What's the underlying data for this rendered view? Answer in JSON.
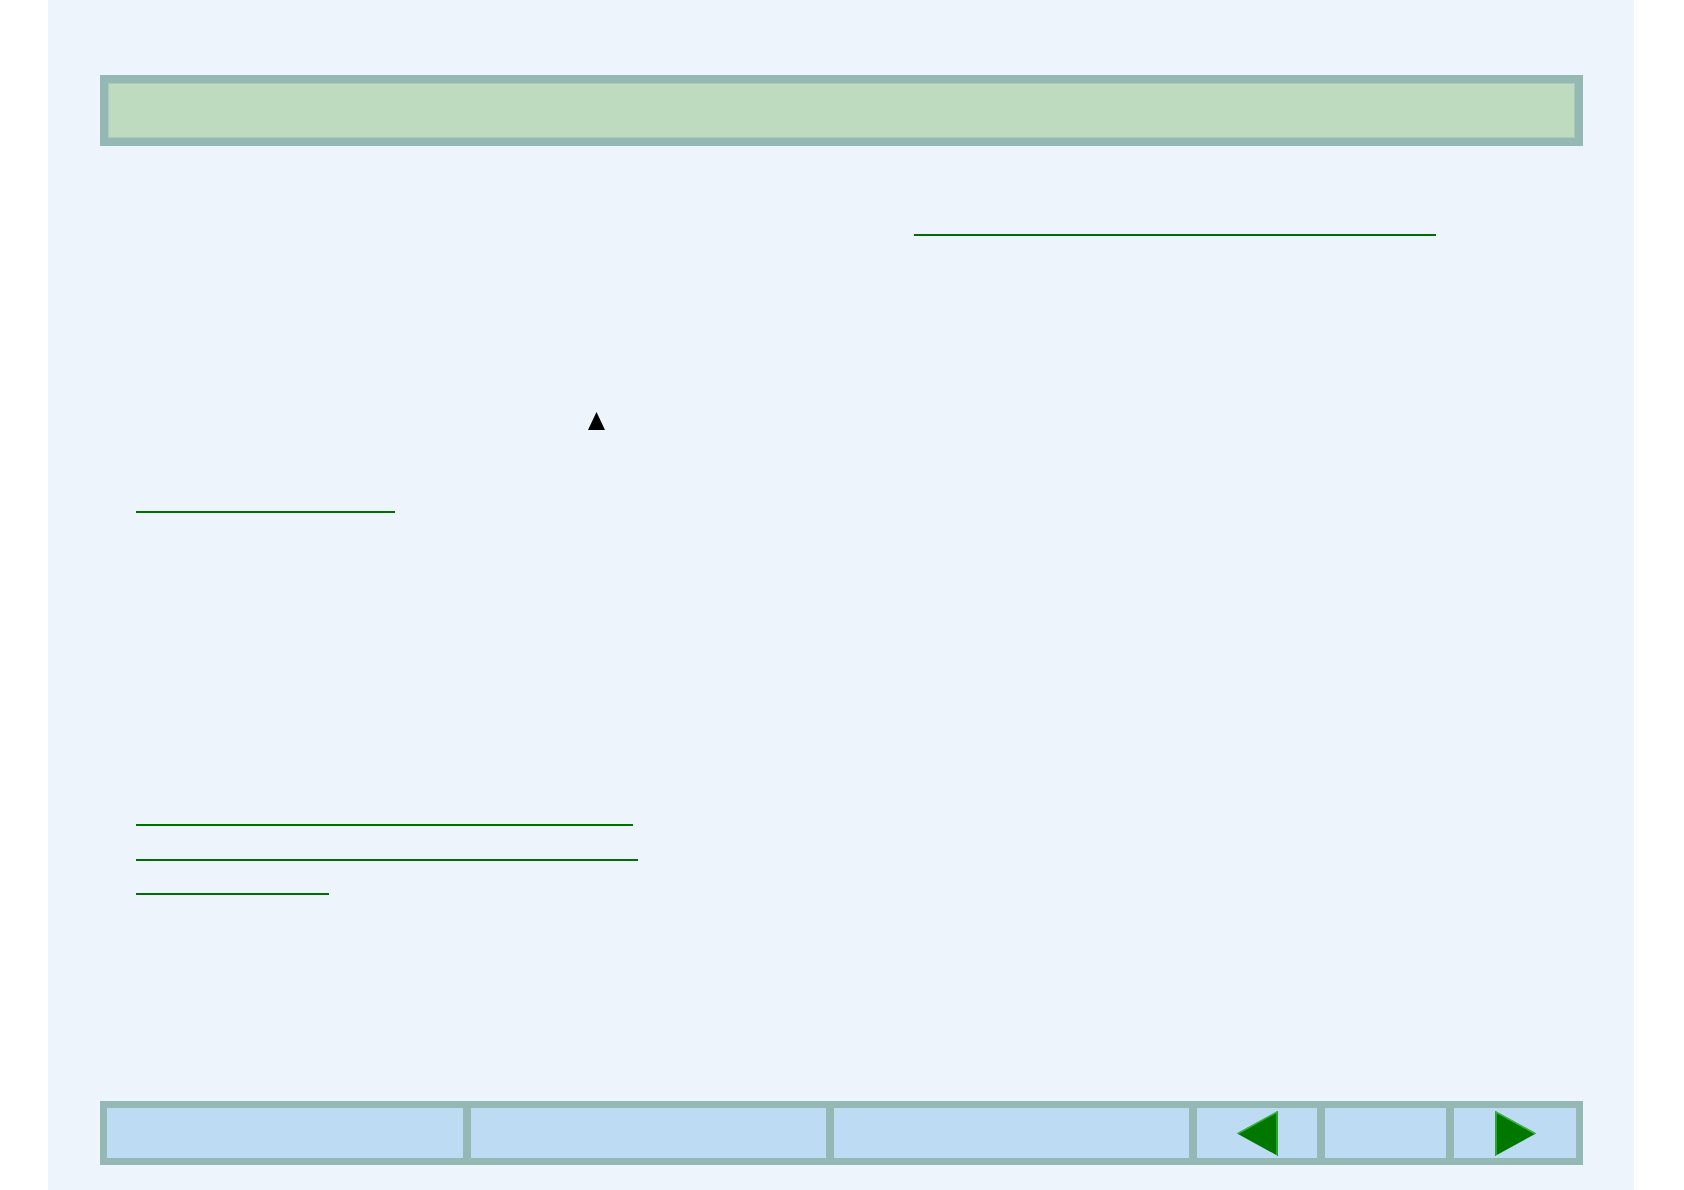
{
  "content": [
    {
      "kind": "link-underline"
    },
    {
      "kind": "up-triangle"
    },
    {
      "kind": "link-underline"
    },
    {
      "kind": "link-underline"
    },
    {
      "kind": "link-underline"
    },
    {
      "kind": "link-underline"
    }
  ],
  "nav_bar": {
    "buttons": [
      {
        "kind": "blank"
      },
      {
        "kind": "blank"
      },
      {
        "kind": "blank"
      },
      {
        "kind": "previous"
      },
      {
        "kind": "blank"
      },
      {
        "kind": "next"
      }
    ]
  }
}
